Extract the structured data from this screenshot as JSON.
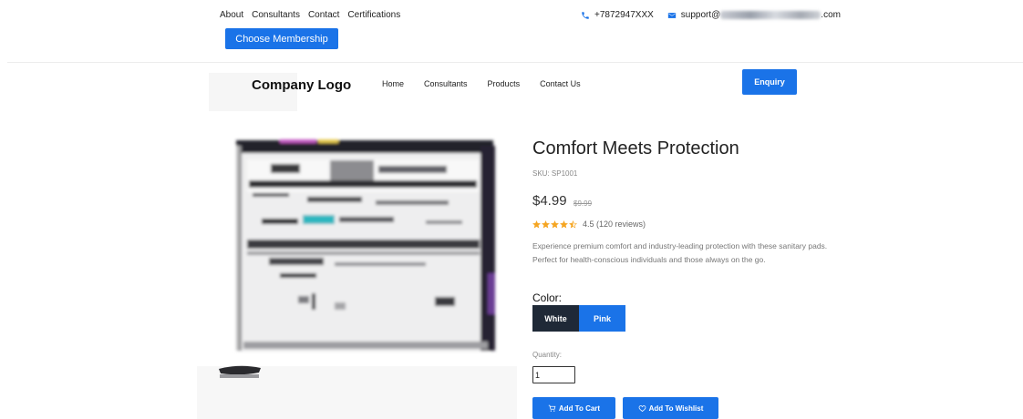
{
  "topbar": {
    "links": [
      "About",
      "Consultants",
      "Contact",
      "Certifications"
    ],
    "phone": "+7872947XXX",
    "email_prefix": "support@",
    "email_suffix": ".com",
    "choose_membership_label": "Choose Membership"
  },
  "header": {
    "logo": "Company Logo",
    "nav": [
      "Home",
      "Consultants",
      "Products",
      "Contact Us"
    ],
    "enquiry_label": "Enquiry"
  },
  "product": {
    "title": "Comfort Meets Protection",
    "sku": "SKU: SP1001",
    "price": "$4.99",
    "old_price": "$9.99",
    "rating_value": 4.5,
    "rating_max": 5,
    "rating_text": "4.5 (120 reviews)",
    "description": "Experience premium comfort and industry-leading protection with these sanitary pads. Perfect for health-conscious individuals and those always on the go.",
    "color_label": "Color:",
    "colors": [
      "White",
      "Pink"
    ],
    "selected_color": "Pink",
    "quantity_label": "Quantity:",
    "quantity_value": "1",
    "add_to_cart_label": "Add To Cart",
    "wishlist_label": "Add To Wishlist"
  },
  "icons": {
    "phone": "phone-icon",
    "email": "envelope-icon",
    "star": "star-icon",
    "cart": "cart-icon",
    "heart": "heart-icon"
  },
  "colors": {
    "accent": "#1a73e8",
    "dark_option": "#1f2937",
    "star": "#f5a623"
  }
}
